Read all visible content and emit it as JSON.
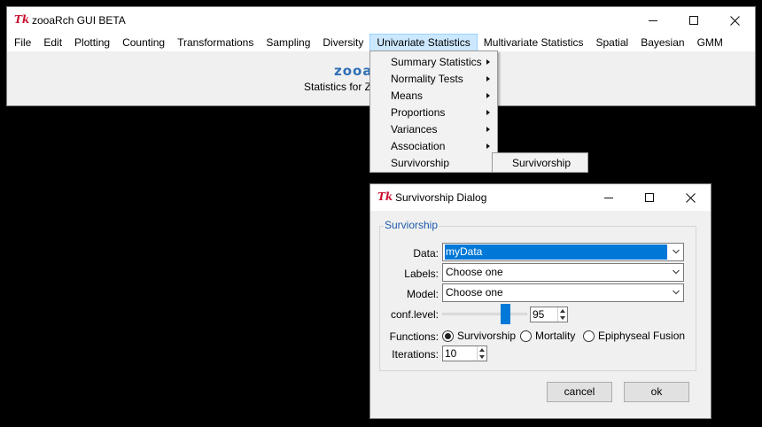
{
  "main_window": {
    "title": "zooaRch GUI BETA",
    "menu": [
      "File",
      "Edit",
      "Plotting",
      "Counting",
      "Transformations",
      "Sampling",
      "Diversity",
      "Univariate Statistics",
      "Multivariate Statistics",
      "Spatial",
      "Bayesian",
      "GMM"
    ],
    "active_menu": "Univariate Statistics",
    "logo_text": "zooa",
    "subtitle_text": "Statistics for Z"
  },
  "univariate_menu": {
    "items": [
      {
        "label": "Summary Statistics",
        "has_submenu": true
      },
      {
        "label": "Normality Tests",
        "has_submenu": true
      },
      {
        "label": "Means",
        "has_submenu": true
      },
      {
        "label": "Proportions",
        "has_submenu": true
      },
      {
        "label": "Variances",
        "has_submenu": true
      },
      {
        "label": "Association",
        "has_submenu": true
      },
      {
        "label": "Survivorship",
        "has_submenu": false
      }
    ],
    "submenu": {
      "items": [
        "Survivorship"
      ]
    }
  },
  "dialog": {
    "title": "Survivorship Dialog",
    "group_label": "Surviorship",
    "data_label": "Data:",
    "data_value": "myData",
    "labels_label": "Labels:",
    "labels_value": "Choose one",
    "model_label": "Model:",
    "model_value": "Choose one",
    "conf_label": "conf.level:",
    "conf_value": "95",
    "conf_slider_fraction": 0.7,
    "functions_label": "Functions:",
    "functions_options": [
      "Survivorship",
      "Mortality",
      "Epiphyseal Fusion"
    ],
    "functions_selected": "Survivorship",
    "iterations_label": "Iterations:",
    "iterations_value": "10",
    "cancel_label": "cancel",
    "ok_label": "ok"
  },
  "colors": {
    "accent": "#0078d7",
    "menu_highlight": "#cce8ff",
    "group_label": "#1d5aa9",
    "tk_icon": "#c8102e"
  },
  "icons": [
    "tk-feather-icon",
    "minimize-icon",
    "maximize-icon",
    "close-icon",
    "chevron-down-icon",
    "submenu-arrow-icon",
    "spin-up-icon",
    "spin-down-icon"
  ]
}
